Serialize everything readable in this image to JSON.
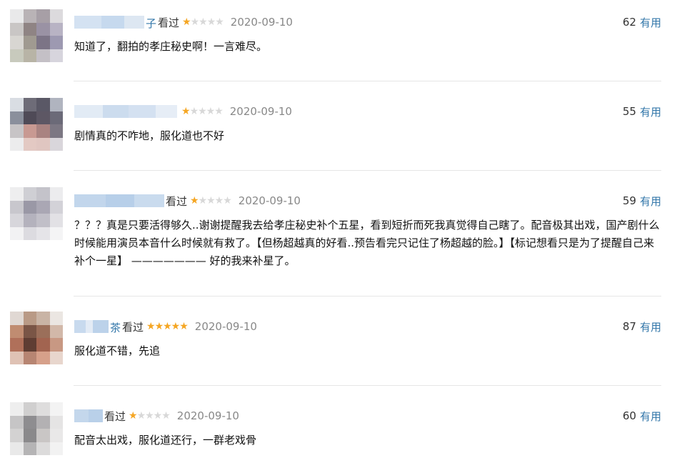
{
  "comments": [
    {
      "name_suffix": "子",
      "status": "看过",
      "rating": 1,
      "date": "2020-09-10",
      "votes": "62",
      "useful_label": "有用",
      "text": "知道了，翻拍的孝庄秘史啊！一言难尽。"
    },
    {
      "name_suffix": "",
      "status": "",
      "rating": 1,
      "date": "2020-09-10",
      "votes": "55",
      "useful_label": "有用",
      "text": "剧情真的不咋地，服化道也不好"
    },
    {
      "name_suffix": "",
      "status": "看过",
      "rating": 1,
      "date": "2020-09-10",
      "votes": "59",
      "useful_label": "有用",
      "text": "？？？真是只要活得够久..谢谢提醒我去给孝庄秘史补个五星，看到短折而死我真觉得自己瞎了。配音极其出戏，国产剧什么时候能用演员本音什么时候就有救了。【但杨超越真的好看..预告看完只记住了杨超越的脸。】【标记想看只是为了提醒自己来补个一星】 ——————— 好的我来补星了。"
    },
    {
      "name_suffix": "茶",
      "status": "看过",
      "rating": 5,
      "date": "2020-09-10",
      "votes": "87",
      "useful_label": "有用",
      "text": "服化道不错，先追"
    },
    {
      "name_suffix": "",
      "status": "看过",
      "rating": 1,
      "date": "2020-09-10",
      "votes": "60",
      "useful_label": "有用",
      "text": "配音太出戏，服化道还行，一群老戏骨"
    }
  ],
  "colors": {
    "star_on": "#f5a623",
    "star_off": "#d8d8d8",
    "useful_link": "#3377aa",
    "date": "#888888",
    "divider": "#e6e6e6"
  }
}
